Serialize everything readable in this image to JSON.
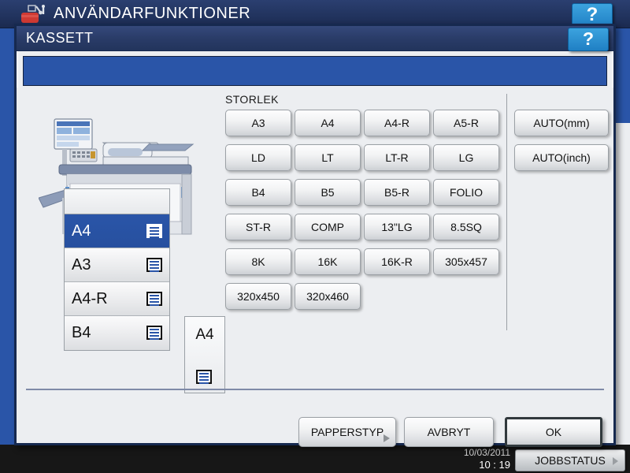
{
  "machine": {
    "title": "ANVÄNDARFUNKTIONER",
    "toolbox_icon": "toolbox-icon",
    "help_label": "?",
    "status": {
      "date": "10/03/2011",
      "time": "10 : 19",
      "jobstatus_label": "JOBBSTATUS",
      "jobstatus_arrow": "triangle-right-icon"
    }
  },
  "dialog": {
    "title": "KASSETT",
    "help_label": "?",
    "size_section_label": "STORLEK",
    "size_buttons": [
      "A3",
      "A4",
      "A4-R",
      "A5-R",
      "LD",
      "LT",
      "LT-R",
      "LG",
      "B4",
      "B5",
      "B5-R",
      "FOLIO",
      "ST-R",
      "COMP",
      "13\"LG",
      "8.5SQ",
      "8K",
      "16K",
      "16K-R",
      "305x457",
      "320x450",
      "320x460"
    ],
    "auto_buttons": [
      "AUTO(mm)",
      "AUTO(inch)"
    ],
    "cassettes": [
      {
        "label": "A4",
        "selected": true,
        "icon": "paper-stack-icon"
      },
      {
        "label": "A3",
        "selected": false,
        "icon": "paper-stack-icon"
      },
      {
        "label": "A4-R",
        "selected": false,
        "icon": "paper-stack-icon"
      },
      {
        "label": "B4",
        "selected": false,
        "icon": "paper-stack-icon"
      }
    ],
    "bypass_tray": {
      "label": "A4",
      "icon": "paper-stack-icon"
    },
    "footer": {
      "papertype_label": "PAPPERSTYP",
      "papertype_arrow": "triangle-right-icon",
      "cancel_label": "AVBRYT",
      "ok_label": "OK"
    }
  },
  "colors": {
    "accent_blue": "#2a55a8",
    "titlebar_navy": "#22345c",
    "help_blue": "#1f7fc4",
    "panel_bg": "#eceef1",
    "status_bar": "#171717"
  }
}
